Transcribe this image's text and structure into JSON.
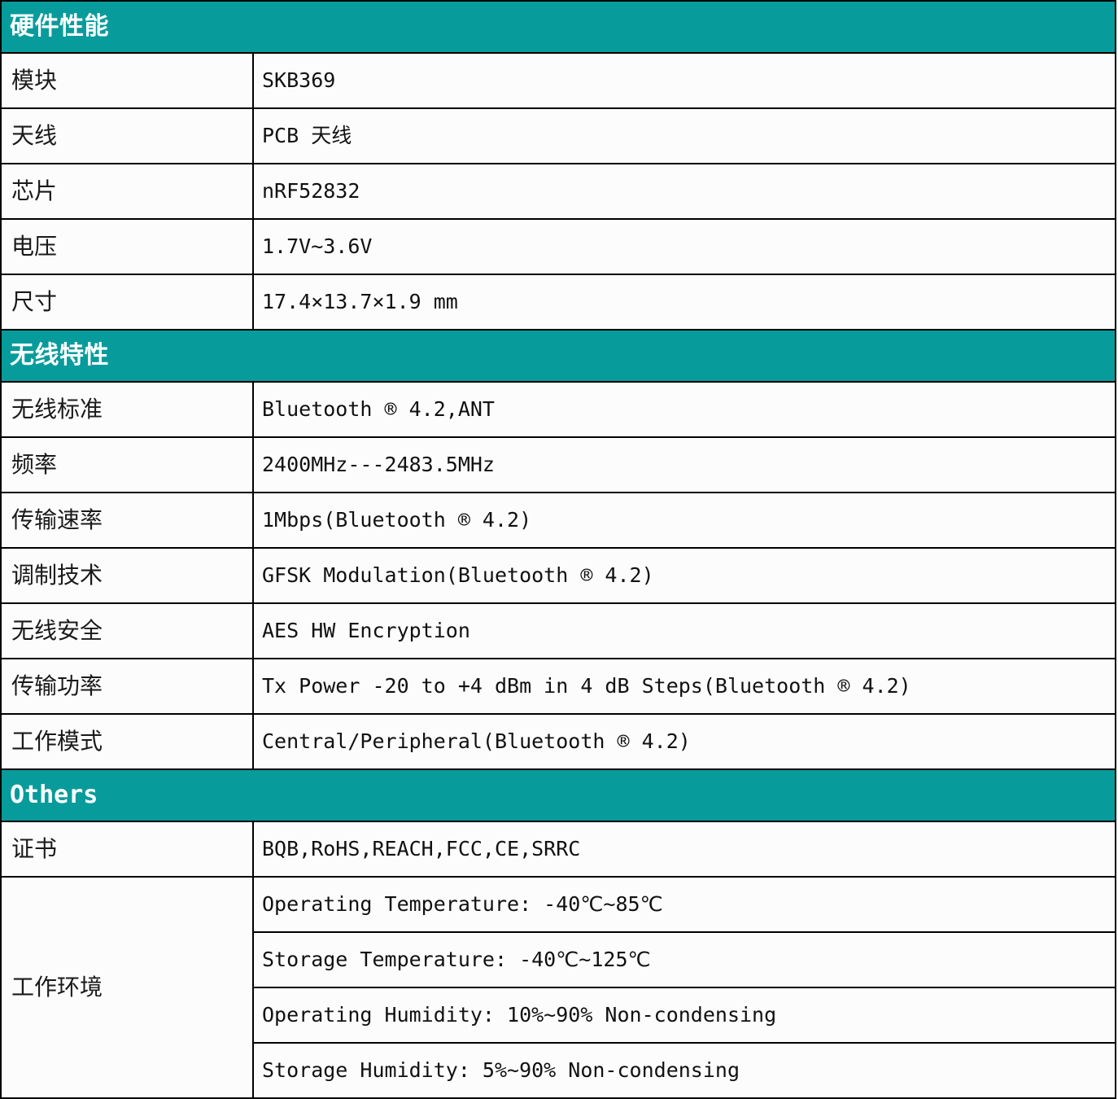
{
  "colors": {
    "section_header_bg": "#089b9b",
    "section_header_text": "#ffffff",
    "border": "#000000",
    "cell_bg": "#fcfcfc",
    "body_text": "#111111"
  },
  "sections": [
    {
      "id": "hardware",
      "title": "硬件性能",
      "title_script": "cjk",
      "rows": [
        {
          "label": "模块",
          "value": "SKB369"
        },
        {
          "label": "天线",
          "value": "PCB  天线"
        },
        {
          "label": "芯片",
          "value": "nRF52832"
        },
        {
          "label": "电压",
          "value": "1.7V~3.6V"
        },
        {
          "label": "尺寸",
          "value": "17.4×13.7×1.9 mm"
        }
      ]
    },
    {
      "id": "wireless",
      "title": "无线特性",
      "title_script": "cjk",
      "rows": [
        {
          "label": "无线标准",
          "value": "Bluetooth ® 4.2,ANT"
        },
        {
          "label": "频率",
          "value": "2400MHz---2483.5MHz"
        },
        {
          "label": "传输速率",
          "value": "1Mbps(Bluetooth ® 4.2)"
        },
        {
          "label": "调制技术",
          "value": "GFSK Modulation(Bluetooth ® 4.2)"
        },
        {
          "label": "无线安全",
          "value": "AES HW Encryption"
        },
        {
          "label": "传输功率",
          "value": "Tx Power -20 to +4 dBm in 4 dB Steps(Bluetooth ® 4.2)"
        },
        {
          "label": "工作模式",
          "value": "Central/Peripheral(Bluetooth ® 4.2)"
        }
      ]
    },
    {
      "id": "others",
      "title": "Others",
      "title_script": "latin",
      "rows": [
        {
          "label": "证书",
          "value": "BQB,RoHS,REACH,FCC,CE,SRRC"
        }
      ],
      "merged_row": {
        "label": "工作环境",
        "values": [
          "Operating Temperature: -40℃~85℃",
          "Storage Temperature: -40℃~125℃",
          "Operating Humidity: 10%~90% Non-condensing",
          "Storage Humidity: 5%~90% Non-condensing"
        ]
      }
    }
  ]
}
